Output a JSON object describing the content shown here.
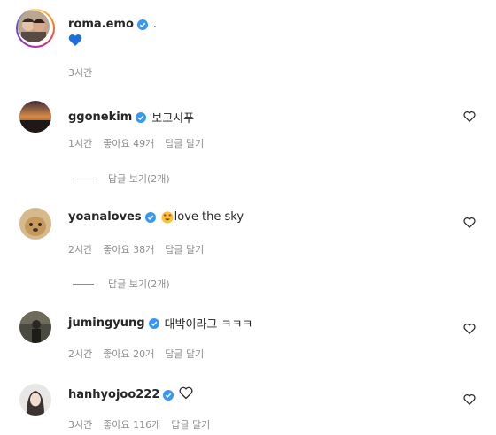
{
  "caption": {
    "username": "roma.emo",
    "suffix": ".",
    "time": "3시간"
  },
  "comments": [
    {
      "username": "ggonekim",
      "text": "보고시푸",
      "time": "1시간",
      "likes": "좋아요 49개",
      "reply": "답글 달기",
      "view_replies": "답글 보기(2개)"
    },
    {
      "username": "yoanaloves",
      "text": "love the sky",
      "time": "2시간",
      "likes": "좋아요 38개",
      "reply": "답글 달기",
      "view_replies": "답글 보기(2개)"
    },
    {
      "username": "jumingyung",
      "text": "대박이라그 ㅋㅋㅋ",
      "time": "2시간",
      "likes": "좋아요 20개",
      "reply": "답글 달기"
    },
    {
      "username": "hanhyojoo222",
      "text": "",
      "time": "3시간",
      "likes": "좋아요 116개",
      "reply": "답글 달기"
    }
  ],
  "colors": {
    "verified": "#3897f0",
    "muted": "#8e8e8e",
    "blue_heart": "#1e6fd9"
  },
  "icons": [
    "verified-badge-icon",
    "blue-heart-icon",
    "like-heart-icon",
    "heart-eyes-emoji-icon",
    "outline-heart-icon"
  ]
}
